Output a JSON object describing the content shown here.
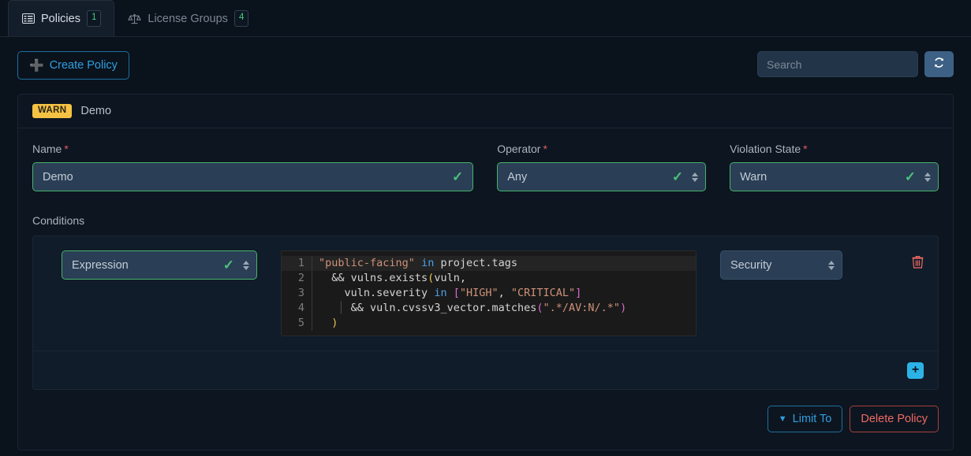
{
  "tabs": [
    {
      "label": "Policies",
      "badge": "1",
      "icon": "list-icon",
      "active": true
    },
    {
      "label": "License Groups",
      "badge": "4",
      "icon": "scales-icon",
      "active": false
    }
  ],
  "toolbar": {
    "create_label": "Create Policy",
    "create_icon": "plus-icon",
    "refresh_icon": "refresh-icon",
    "refresh_glyph": "↻"
  },
  "search": {
    "value": "",
    "placeholder": "Search"
  },
  "policy": {
    "state_badge": "WARN",
    "title": "Demo",
    "name": {
      "label": "Name",
      "required": "*",
      "value": "Demo",
      "valid_icon": "check-icon"
    },
    "operator": {
      "label": "Operator",
      "required": "*",
      "value": "Any",
      "valid_icon": "check-icon"
    },
    "violation_state": {
      "label": "Violation State",
      "required": "*",
      "value": "Warn",
      "valid_icon": "check-icon"
    },
    "conditions_label": "Conditions",
    "condition": {
      "type_value": "Expression",
      "subject_value": "Security",
      "delete_icon": "trash-icon",
      "code_lines": [
        {
          "n": "1",
          "tokens": [
            {
              "t": "\"public-facing\"",
              "c": "s-str"
            },
            {
              "t": " ",
              "c": "s-plain"
            },
            {
              "t": "in",
              "c": "s-key"
            },
            {
              "t": " project.tags",
              "c": "s-plain"
            }
          ]
        },
        {
          "n": "2",
          "tokens": [
            {
              "t": "  && vulns.exists",
              "c": "s-plain"
            },
            {
              "t": "(",
              "c": "s-par"
            },
            {
              "t": "vuln,",
              "c": "s-plain"
            }
          ]
        },
        {
          "n": "3",
          "tokens": [
            {
              "t": "    vuln.severity ",
              "c": "s-plain"
            },
            {
              "t": "in",
              "c": "s-key"
            },
            {
              "t": " ",
              "c": "s-plain"
            },
            {
              "t": "[",
              "c": "s-brk"
            },
            {
              "t": "\"HIGH\"",
              "c": "s-str"
            },
            {
              "t": ", ",
              "c": "s-plain"
            },
            {
              "t": "\"CRITICAL\"",
              "c": "s-str"
            },
            {
              "t": "]",
              "c": "s-brk"
            }
          ]
        },
        {
          "n": "4",
          "tokens": [
            {
              "t": "   ",
              "c": "s-plain"
            },
            {
              "t": "│",
              "c": "indent-guide"
            },
            {
              "t": " && vuln.cvssv3_vector.matches",
              "c": "s-plain"
            },
            {
              "t": "(",
              "c": "s-brk"
            },
            {
              "t": "\".*/AV:N/.*\"",
              "c": "s-str"
            },
            {
              "t": ")",
              "c": "s-brk"
            }
          ]
        },
        {
          "n": "5",
          "tokens": [
            {
              "t": "  ",
              "c": "s-plain"
            },
            {
              "t": ")",
              "c": "s-par"
            }
          ]
        }
      ]
    },
    "add_condition_icon": "plus-icon",
    "add_condition_glyph": "+",
    "limit_to_label": "Limit To",
    "limit_to_icon": "chevron-down-icon",
    "delete_policy_label": "Delete Policy"
  },
  "colors": {
    "warn": "#f5c244",
    "valid": "#47b36b",
    "accent": "#2f9fe0",
    "danger": "#ef6a63",
    "add": "#2bb3e8"
  }
}
